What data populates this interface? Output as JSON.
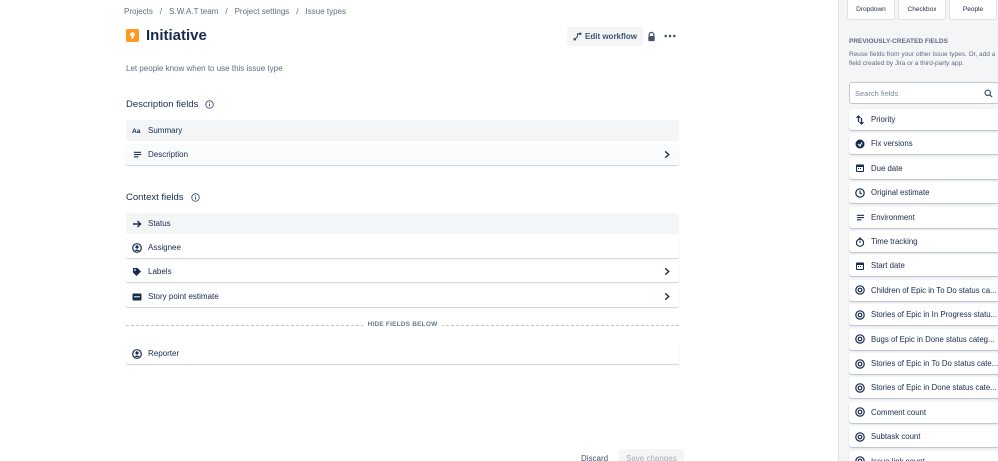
{
  "breadcrumb": [
    "Projects",
    "S.W.A.T team",
    "Project settings",
    "Issue types"
  ],
  "breadcrumb_sep": "/",
  "page": {
    "title": "Initiative",
    "description": "Let people know when to use this issue type",
    "edit_workflow_label": "Edit workflow",
    "more_label": "•••"
  },
  "description_fields": {
    "title": "Description fields",
    "items": [
      {
        "label": "Summary",
        "icon": "text-format-icon"
      },
      {
        "label": "Description",
        "icon": "paragraph-icon"
      }
    ]
  },
  "context_fields": {
    "title": "Context fields",
    "items": [
      {
        "label": "Status",
        "icon": "arrow-right-icon"
      },
      {
        "label": "Assignee",
        "icon": "person-icon"
      },
      {
        "label": "Labels",
        "icon": "tag-icon"
      },
      {
        "label": "Story point estimate",
        "icon": "number-icon"
      }
    ],
    "hide_label": "HIDE FIELDS BELOW",
    "hidden_items": [
      {
        "label": "Reporter",
        "icon": "person-icon"
      }
    ]
  },
  "footer": {
    "discard_label": "Discard",
    "save_label": "Save changes"
  },
  "sidebar": {
    "field_types": [
      "Dropdown",
      "Checkbox",
      "People"
    ],
    "previous_title": "PREVIOUSLY-CREATED FIELDS",
    "previous_desc": "Reuse fields from your other issue types. Or, add a field created by Jira or a third-party app.",
    "search_placeholder": "Search fields",
    "fields": [
      {
        "label": "Priority",
        "icon": "priority-icon"
      },
      {
        "label": "Fix versions",
        "icon": "ship-icon"
      },
      {
        "label": "Due date",
        "icon": "calendar-icon"
      },
      {
        "label": "Original estimate",
        "icon": "clock-icon"
      },
      {
        "label": "Environment",
        "icon": "paragraph-icon"
      },
      {
        "label": "Time tracking",
        "icon": "stopwatch-icon"
      },
      {
        "label": "Start date",
        "icon": "calendar-icon"
      },
      {
        "label": "Children of Epic in To Do status ca...",
        "icon": "formula-icon"
      },
      {
        "label": "Stories of Epic in In Progress statu...",
        "icon": "formula-icon"
      },
      {
        "label": "Bugs of Epic in Done status categ...",
        "icon": "formula-icon"
      },
      {
        "label": "Stories of Epic in To Do status cate...",
        "icon": "formula-icon"
      },
      {
        "label": "Stories of Epic in Done status cate...",
        "icon": "formula-icon"
      },
      {
        "label": "Comment count",
        "icon": "formula-icon"
      },
      {
        "label": "Subtask count",
        "icon": "formula-icon"
      },
      {
        "label": "Issue link count",
        "icon": "formula-icon"
      }
    ]
  },
  "colors": {
    "accent": "#ff991f",
    "text": "#172b4d",
    "subtle": "#5e6c84"
  }
}
